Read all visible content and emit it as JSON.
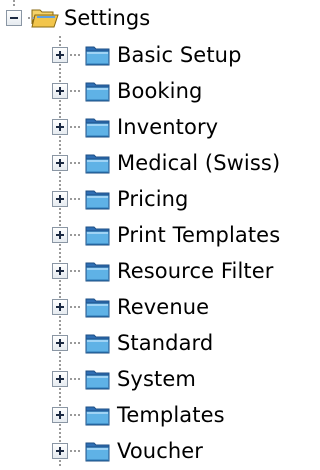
{
  "tree": {
    "root": {
      "label": "Settings",
      "expanded": true,
      "expander": "minus",
      "icon": "open-folder-icon"
    },
    "children": [
      {
        "label": "Basic Setup",
        "expander": "plus",
        "icon": "folder-icon"
      },
      {
        "label": "Booking",
        "expander": "plus",
        "icon": "folder-icon"
      },
      {
        "label": "Inventory",
        "expander": "plus",
        "icon": "folder-icon"
      },
      {
        "label": "Medical (Swiss)",
        "expander": "plus",
        "icon": "folder-icon"
      },
      {
        "label": "Pricing",
        "expander": "plus",
        "icon": "folder-icon"
      },
      {
        "label": "Print Templates",
        "expander": "plus",
        "icon": "folder-icon"
      },
      {
        "label": "Resource Filter",
        "expander": "plus",
        "icon": "folder-icon"
      },
      {
        "label": "Revenue",
        "expander": "plus",
        "icon": "folder-icon"
      },
      {
        "label": "Standard",
        "expander": "plus",
        "icon": "folder-icon"
      },
      {
        "label": "System",
        "expander": "plus",
        "icon": "folder-icon"
      },
      {
        "label": "Templates",
        "expander": "plus",
        "icon": "folder-icon"
      },
      {
        "label": "Voucher",
        "expander": "plus",
        "icon": "folder-icon"
      }
    ]
  },
  "colors": {
    "text": "#000000",
    "background": "#ffffff",
    "connector": "#9a9a9a",
    "expander_border": "#8a96a4",
    "expander_glyph": "#1c2a42",
    "folder_body": "#5fb2e6",
    "folder_tab": "#2f6fb4",
    "open_folder_yellow": "#f2c54b"
  }
}
